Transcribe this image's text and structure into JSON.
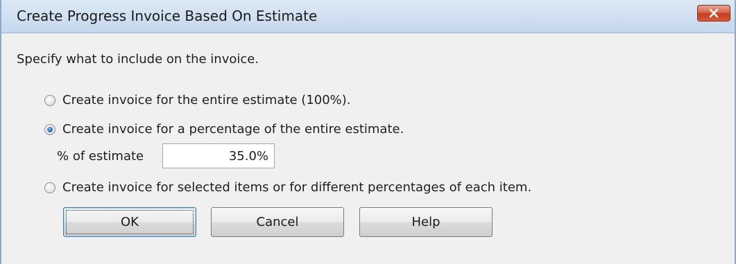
{
  "window": {
    "title": "Create Progress Invoice Based On Estimate",
    "close_icon": "close-icon",
    "close_color": "#c43b1f"
  },
  "instructions": "Specify what to include on the invoice.",
  "options": [
    {
      "label": "Create invoice for the entire estimate (100%).",
      "selected": false
    },
    {
      "label": "Create invoice for a percentage of the entire estimate.",
      "selected": true
    },
    {
      "label": "Create invoice for selected items or for different percentages of each item.",
      "selected": false
    }
  ],
  "percent_field": {
    "label": "% of estimate",
    "value": "35.0%"
  },
  "buttons": {
    "ok": "OK",
    "cancel": "Cancel",
    "help": "Help"
  }
}
